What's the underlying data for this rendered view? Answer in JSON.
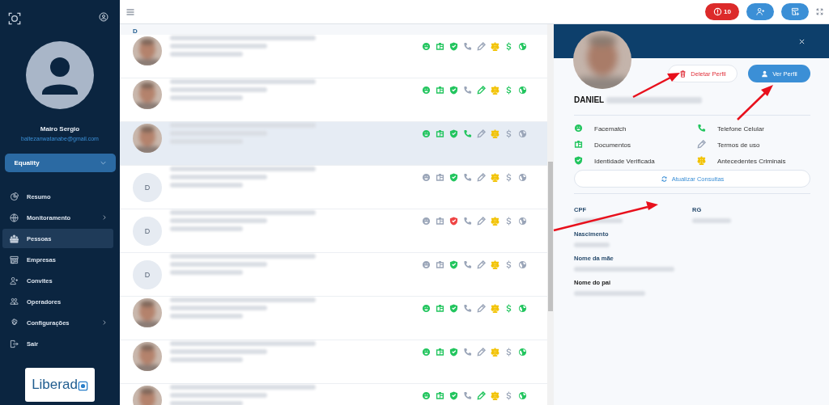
{
  "sidebar": {
    "user": {
      "name": "Mairo Sergio",
      "email": "baltezanwatanabe@gmail.com"
    },
    "org_select": {
      "value": "Equality"
    },
    "menu": [
      {
        "label": "Resumo",
        "selected": false,
        "has_submenu": false
      },
      {
        "label": "Monitoramento",
        "selected": false,
        "has_submenu": true
      },
      {
        "label": "Pessoas",
        "selected": true,
        "has_submenu": false
      },
      {
        "label": "Empresas",
        "selected": false,
        "has_submenu": false
      },
      {
        "label": "Convites",
        "selected": false,
        "has_submenu": false
      },
      {
        "label": "Operadores",
        "selected": false,
        "has_submenu": false
      },
      {
        "label": "Configurações",
        "selected": false,
        "has_submenu": true
      },
      {
        "label": "Sair",
        "selected": false,
        "has_submenu": false
      }
    ],
    "logo": {
      "text": "Liberad"
    }
  },
  "topbar": {
    "alert_badge": "10"
  },
  "list": {
    "section": "D",
    "rows": [
      {
        "selected": false,
        "checks": [
          {
            "kind": "face",
            "color": "#22c55e"
          },
          {
            "kind": "document",
            "color": "#22c55e"
          },
          {
            "kind": "shield",
            "color": "#22c55e"
          },
          {
            "kind": "phone",
            "color": "#9aa5b8"
          },
          {
            "kind": "pen",
            "color": "#9aa5b8"
          },
          {
            "kind": "scale",
            "color": "#f2c200"
          },
          {
            "kind": "dollar",
            "color": "#22c55e"
          },
          {
            "kind": "globe",
            "color": "#22c55e"
          }
        ]
      },
      {
        "selected": false,
        "checks": [
          {
            "kind": "face",
            "color": "#22c55e"
          },
          {
            "kind": "document",
            "color": "#22c55e"
          },
          {
            "kind": "shield",
            "color": "#22c55e"
          },
          {
            "kind": "phone",
            "color": "#9aa5b8"
          },
          {
            "kind": "pen",
            "color": "#22c55e"
          },
          {
            "kind": "scale",
            "color": "#f2c200"
          },
          {
            "kind": "dollar",
            "color": "#22c55e"
          },
          {
            "kind": "globe",
            "color": "#22c55e"
          }
        ]
      },
      {
        "selected": true,
        "checks": [
          {
            "kind": "face",
            "color": "#22c55e"
          },
          {
            "kind": "document",
            "color": "#22c55e"
          },
          {
            "kind": "shield",
            "color": "#22c55e"
          },
          {
            "kind": "phone",
            "color": "#22c55e"
          },
          {
            "kind": "pen",
            "color": "#9aa5b8"
          },
          {
            "kind": "scale",
            "color": "#f2c200"
          },
          {
            "kind": "dollar",
            "color": "#9aa5b8"
          },
          {
            "kind": "globe",
            "color": "#9aa5b8"
          }
        ]
      },
      {
        "kind": "initial",
        "initial": "D",
        "selected": false,
        "checks": [
          {
            "kind": "face",
            "color": "#9aa5b8"
          },
          {
            "kind": "document",
            "color": "#9aa5b8"
          },
          {
            "kind": "shield",
            "color": "#22c55e"
          },
          {
            "kind": "phone",
            "color": "#9aa5b8"
          },
          {
            "kind": "pen",
            "color": "#9aa5b8"
          },
          {
            "kind": "scale",
            "color": "#f2c200"
          },
          {
            "kind": "dollar",
            "color": "#9aa5b8"
          },
          {
            "kind": "globe",
            "color": "#9aa5b8"
          }
        ]
      },
      {
        "kind": "initial",
        "initial": "D",
        "selected": false,
        "checks": [
          {
            "kind": "face",
            "color": "#9aa5b8"
          },
          {
            "kind": "document",
            "color": "#9aa5b8"
          },
          {
            "kind": "shield",
            "color": "#ef4444"
          },
          {
            "kind": "phone",
            "color": "#9aa5b8"
          },
          {
            "kind": "pen",
            "color": "#9aa5b8"
          },
          {
            "kind": "scale",
            "color": "#f2c200"
          },
          {
            "kind": "dollar",
            "color": "#9aa5b8"
          },
          {
            "kind": "globe",
            "color": "#9aa5b8"
          }
        ]
      },
      {
        "kind": "initial",
        "initial": "D",
        "selected": false,
        "checks": [
          {
            "kind": "face",
            "color": "#9aa5b8"
          },
          {
            "kind": "document",
            "color": "#9aa5b8"
          },
          {
            "kind": "shield",
            "color": "#22c55e"
          },
          {
            "kind": "phone",
            "color": "#9aa5b8"
          },
          {
            "kind": "pen",
            "color": "#9aa5b8"
          },
          {
            "kind": "scale",
            "color": "#f2c200"
          },
          {
            "kind": "dollar",
            "color": "#9aa5b8"
          },
          {
            "kind": "globe",
            "color": "#9aa5b8"
          }
        ]
      },
      {
        "selected": false,
        "checks": [
          {
            "kind": "face",
            "color": "#22c55e"
          },
          {
            "kind": "document",
            "color": "#22c55e"
          },
          {
            "kind": "shield",
            "color": "#22c55e"
          },
          {
            "kind": "phone",
            "color": "#9aa5b8"
          },
          {
            "kind": "pen",
            "color": "#9aa5b8"
          },
          {
            "kind": "scale",
            "color": "#f2c200"
          },
          {
            "kind": "dollar",
            "color": "#22c55e"
          },
          {
            "kind": "globe",
            "color": "#22c55e"
          }
        ]
      },
      {
        "selected": false,
        "checks": [
          {
            "kind": "face",
            "color": "#22c55e"
          },
          {
            "kind": "document",
            "color": "#22c55e"
          },
          {
            "kind": "shield",
            "color": "#22c55e"
          },
          {
            "kind": "phone",
            "color": "#9aa5b8"
          },
          {
            "kind": "pen",
            "color": "#9aa5b8"
          },
          {
            "kind": "scale",
            "color": "#f2c200"
          },
          {
            "kind": "dollar",
            "color": "#9aa5b8"
          },
          {
            "kind": "globe",
            "color": "#22c55e"
          }
        ]
      },
      {
        "selected": false,
        "checks": [
          {
            "kind": "face",
            "color": "#22c55e"
          },
          {
            "kind": "document",
            "color": "#22c55e"
          },
          {
            "kind": "shield",
            "color": "#22c55e"
          },
          {
            "kind": "phone",
            "color": "#9aa5b8"
          },
          {
            "kind": "pen",
            "color": "#22c55e"
          },
          {
            "kind": "scale",
            "color": "#f2c200"
          },
          {
            "kind": "dollar",
            "color": "#9aa5b8"
          },
          {
            "kind": "globe",
            "color": "#22c55e"
          }
        ]
      }
    ]
  },
  "detail": {
    "name": "DANIEL",
    "delete_button": "Deletar Perfil",
    "view_button": "Ver Perfil",
    "checks": [
      {
        "label": "Facematch",
        "kind": "face",
        "color": "#22c55e"
      },
      {
        "label": "Telefone Celular",
        "kind": "phone",
        "color": "#22c55e"
      },
      {
        "label": "Documentos",
        "kind": "document",
        "color": "#22c55e"
      },
      {
        "label": "Termos de uso",
        "kind": "pen",
        "color": "#9aa5b8"
      },
      {
        "label": "Identidade Verificada",
        "kind": "shield",
        "color": "#22c55e"
      },
      {
        "label": "Antecedentes Criminais",
        "kind": "scale",
        "color": "#f2c200"
      }
    ],
    "refresh_button": "Atualizar Consultas",
    "fields": [
      {
        "label": "CPF"
      },
      {
        "label": "RG"
      },
      {
        "label": "Nascimento"
      },
      {
        "label": "Nome da mãe"
      },
      {
        "label": "Nome do pai"
      }
    ]
  }
}
